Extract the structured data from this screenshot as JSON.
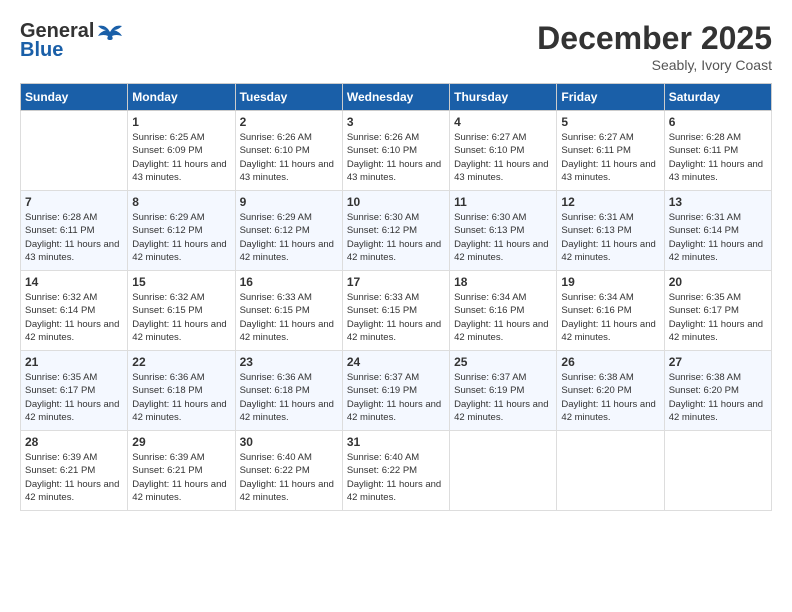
{
  "logo": {
    "general": "General",
    "blue": "Blue"
  },
  "header": {
    "title": "December 2025",
    "subtitle": "Seably, Ivory Coast"
  },
  "calendar": {
    "weekdays": [
      "Sunday",
      "Monday",
      "Tuesday",
      "Wednesday",
      "Thursday",
      "Friday",
      "Saturday"
    ],
    "weeks": [
      [
        {
          "day": "",
          "empty": true
        },
        {
          "day": "1",
          "sunrise": "Sunrise: 6:25 AM",
          "sunset": "Sunset: 6:09 PM",
          "daylight": "Daylight: 11 hours and 43 minutes."
        },
        {
          "day": "2",
          "sunrise": "Sunrise: 6:26 AM",
          "sunset": "Sunset: 6:10 PM",
          "daylight": "Daylight: 11 hours and 43 minutes."
        },
        {
          "day": "3",
          "sunrise": "Sunrise: 6:26 AM",
          "sunset": "Sunset: 6:10 PM",
          "daylight": "Daylight: 11 hours and 43 minutes."
        },
        {
          "day": "4",
          "sunrise": "Sunrise: 6:27 AM",
          "sunset": "Sunset: 6:10 PM",
          "daylight": "Daylight: 11 hours and 43 minutes."
        },
        {
          "day": "5",
          "sunrise": "Sunrise: 6:27 AM",
          "sunset": "Sunset: 6:11 PM",
          "daylight": "Daylight: 11 hours and 43 minutes."
        },
        {
          "day": "6",
          "sunrise": "Sunrise: 6:28 AM",
          "sunset": "Sunset: 6:11 PM",
          "daylight": "Daylight: 11 hours and 43 minutes."
        }
      ],
      [
        {
          "day": "7",
          "sunrise": "Sunrise: 6:28 AM",
          "sunset": "Sunset: 6:11 PM",
          "daylight": "Daylight: 11 hours and 43 minutes."
        },
        {
          "day": "8",
          "sunrise": "Sunrise: 6:29 AM",
          "sunset": "Sunset: 6:12 PM",
          "daylight": "Daylight: 11 hours and 42 minutes."
        },
        {
          "day": "9",
          "sunrise": "Sunrise: 6:29 AM",
          "sunset": "Sunset: 6:12 PM",
          "daylight": "Daylight: 11 hours and 42 minutes."
        },
        {
          "day": "10",
          "sunrise": "Sunrise: 6:30 AM",
          "sunset": "Sunset: 6:12 PM",
          "daylight": "Daylight: 11 hours and 42 minutes."
        },
        {
          "day": "11",
          "sunrise": "Sunrise: 6:30 AM",
          "sunset": "Sunset: 6:13 PM",
          "daylight": "Daylight: 11 hours and 42 minutes."
        },
        {
          "day": "12",
          "sunrise": "Sunrise: 6:31 AM",
          "sunset": "Sunset: 6:13 PM",
          "daylight": "Daylight: 11 hours and 42 minutes."
        },
        {
          "day": "13",
          "sunrise": "Sunrise: 6:31 AM",
          "sunset": "Sunset: 6:14 PM",
          "daylight": "Daylight: 11 hours and 42 minutes."
        }
      ],
      [
        {
          "day": "14",
          "sunrise": "Sunrise: 6:32 AM",
          "sunset": "Sunset: 6:14 PM",
          "daylight": "Daylight: 11 hours and 42 minutes."
        },
        {
          "day": "15",
          "sunrise": "Sunrise: 6:32 AM",
          "sunset": "Sunset: 6:15 PM",
          "daylight": "Daylight: 11 hours and 42 minutes."
        },
        {
          "day": "16",
          "sunrise": "Sunrise: 6:33 AM",
          "sunset": "Sunset: 6:15 PM",
          "daylight": "Daylight: 11 hours and 42 minutes."
        },
        {
          "day": "17",
          "sunrise": "Sunrise: 6:33 AM",
          "sunset": "Sunset: 6:15 PM",
          "daylight": "Daylight: 11 hours and 42 minutes."
        },
        {
          "day": "18",
          "sunrise": "Sunrise: 6:34 AM",
          "sunset": "Sunset: 6:16 PM",
          "daylight": "Daylight: 11 hours and 42 minutes."
        },
        {
          "day": "19",
          "sunrise": "Sunrise: 6:34 AM",
          "sunset": "Sunset: 6:16 PM",
          "daylight": "Daylight: 11 hours and 42 minutes."
        },
        {
          "day": "20",
          "sunrise": "Sunrise: 6:35 AM",
          "sunset": "Sunset: 6:17 PM",
          "daylight": "Daylight: 11 hours and 42 minutes."
        }
      ],
      [
        {
          "day": "21",
          "sunrise": "Sunrise: 6:35 AM",
          "sunset": "Sunset: 6:17 PM",
          "daylight": "Daylight: 11 hours and 42 minutes."
        },
        {
          "day": "22",
          "sunrise": "Sunrise: 6:36 AM",
          "sunset": "Sunset: 6:18 PM",
          "daylight": "Daylight: 11 hours and 42 minutes."
        },
        {
          "day": "23",
          "sunrise": "Sunrise: 6:36 AM",
          "sunset": "Sunset: 6:18 PM",
          "daylight": "Daylight: 11 hours and 42 minutes."
        },
        {
          "day": "24",
          "sunrise": "Sunrise: 6:37 AM",
          "sunset": "Sunset: 6:19 PM",
          "daylight": "Daylight: 11 hours and 42 minutes."
        },
        {
          "day": "25",
          "sunrise": "Sunrise: 6:37 AM",
          "sunset": "Sunset: 6:19 PM",
          "daylight": "Daylight: 11 hours and 42 minutes."
        },
        {
          "day": "26",
          "sunrise": "Sunrise: 6:38 AM",
          "sunset": "Sunset: 6:20 PM",
          "daylight": "Daylight: 11 hours and 42 minutes."
        },
        {
          "day": "27",
          "sunrise": "Sunrise: 6:38 AM",
          "sunset": "Sunset: 6:20 PM",
          "daylight": "Daylight: 11 hours and 42 minutes."
        }
      ],
      [
        {
          "day": "28",
          "sunrise": "Sunrise: 6:39 AM",
          "sunset": "Sunset: 6:21 PM",
          "daylight": "Daylight: 11 hours and 42 minutes."
        },
        {
          "day": "29",
          "sunrise": "Sunrise: 6:39 AM",
          "sunset": "Sunset: 6:21 PM",
          "daylight": "Daylight: 11 hours and 42 minutes."
        },
        {
          "day": "30",
          "sunrise": "Sunrise: 6:40 AM",
          "sunset": "Sunset: 6:22 PM",
          "daylight": "Daylight: 11 hours and 42 minutes."
        },
        {
          "day": "31",
          "sunrise": "Sunrise: 6:40 AM",
          "sunset": "Sunset: 6:22 PM",
          "daylight": "Daylight: 11 hours and 42 minutes."
        },
        {
          "day": "",
          "empty": true
        },
        {
          "day": "",
          "empty": true
        },
        {
          "day": "",
          "empty": true
        }
      ]
    ]
  }
}
